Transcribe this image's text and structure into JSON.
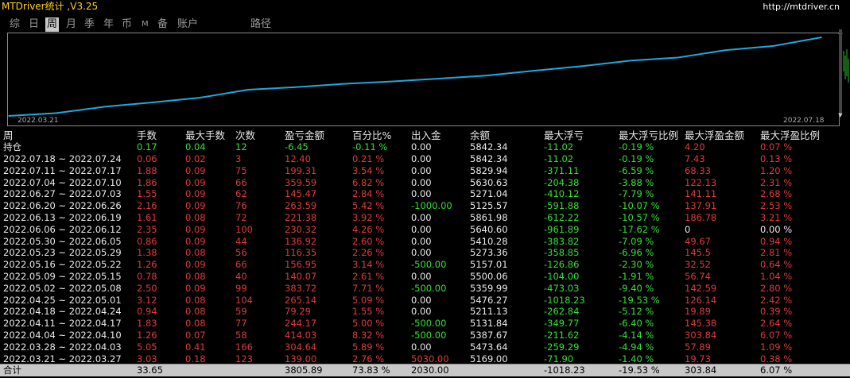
{
  "app": {
    "title": "MTDriver统计 ,V3.25",
    "site": "http://mtdriver.cn"
  },
  "tabs": [
    {
      "label": "综"
    },
    {
      "label": "日"
    },
    {
      "label": "周",
      "active": true
    },
    {
      "label": "月"
    },
    {
      "label": "季"
    },
    {
      "label": "年"
    },
    {
      "label": "币"
    },
    {
      "label": "M"
    },
    {
      "label": "备"
    },
    {
      "label": "账户"
    },
    {
      "label": "路径"
    }
  ],
  "chart_data": {
    "type": "line",
    "x_start_label": "2022.03.21",
    "x_end_label": "2022.07.18",
    "line_color": "#1fa8dc",
    "series": [
      {
        "values": [
          0,
          139.0,
          443.64,
          648.38,
          880.42,
          1263.37,
          1386.31,
          1543.25,
          1659.6,
          1797.32,
          1947.24,
          2177.56,
          2398.94,
          2662.53,
          2810.0,
          3169.59,
          3369.11,
          3783.49
        ]
      }
    ],
    "ylim": [
      0,
      3900
    ]
  },
  "table": {
    "headers": [
      "周",
      "手数",
      "最大手数",
      "次数",
      "盈亏金额",
      "百分比%",
      "出入金",
      "余额",
      "最大浮亏",
      "最大浮亏比例",
      "最大浮盈金额",
      "最大浮盈比例"
    ],
    "holding": [
      "持仓",
      "0.17",
      "0.04",
      "12",
      "-6.45",
      "-0.11 %",
      "0.00",
      "5842.34",
      "-11.02",
      "-0.19 %",
      "4.20",
      "0.07 %"
    ],
    "rows": [
      [
        "2022.07.18 ~ 2022.07.24",
        "0.06",
        "0.02",
        "3",
        "12.40",
        "0.21 %",
        "0.00",
        "5842.34",
        "-11.02",
        "-0.19 %",
        "7.43",
        "0.13 %"
      ],
      [
        "2022.07.11 ~ 2022.07.17",
        "1.88",
        "0.09",
        "75",
        "199.31",
        "3.54 %",
        "0.00",
        "5829.94",
        "-371.11",
        "-6.59 %",
        "68.33",
        "1.20 %"
      ],
      [
        "2022.07.04 ~ 2022.07.10",
        "1.86",
        "0.09",
        "66",
        "359.59",
        "6.82 %",
        "0.00",
        "5630.63",
        "-204.38",
        "-3.88 %",
        "122.13",
        "2.31 %"
      ],
      [
        "2022.06.27 ~ 2022.07.03",
        "1.55",
        "0.09",
        "62",
        "145.47",
        "2.84 %",
        "0.00",
        "5271.04",
        "-410.12",
        "-7.79 %",
        "141.11",
        "2.68 %"
      ],
      [
        "2022.06.20 ~ 2022.06.26",
        "2.16",
        "0.09",
        "76",
        "263.59",
        "5.42 %",
        "-1000.00",
        "5125.57",
        "-591.88",
        "-10.07 %",
        "137.91",
        "2.53 %"
      ],
      [
        "2022.06.13 ~ 2022.06.19",
        "1.61",
        "0.08",
        "72",
        "221.38",
        "3.92 %",
        "0.00",
        "5861.98",
        "-612.22",
        "-10.57 %",
        "186.78",
        "3.21 %"
      ],
      [
        "2022.06.06 ~ 2022.06.12",
        "2.35",
        "0.09",
        "100",
        "230.32",
        "4.26 %",
        "0.00",
        "5640.60",
        "-961.89",
        "-17.62 %",
        "0",
        "0.00 %"
      ],
      [
        "2022.05.30 ~ 2022.06.05",
        "0.86",
        "0.09",
        "44",
        "136.92",
        "2.60 %",
        "0.00",
        "5410.28",
        "-383.82",
        "-7.09 %",
        "49.67",
        "0.94 %"
      ],
      [
        "2022.05.23 ~ 2022.05.29",
        "1.38",
        "0.08",
        "56",
        "116.35",
        "2.26 %",
        "0.00",
        "5273.36",
        "-358.85",
        "-6.96 %",
        "145.5",
        "2.81 %"
      ],
      [
        "2022.05.16 ~ 2022.05.22",
        "1.26",
        "0.09",
        "66",
        "156.95",
        "3.14 %",
        "-500.00",
        "5157.01",
        "-126.86",
        "-2.30 %",
        "32.52",
        "0.64 %"
      ],
      [
        "2022.05.09 ~ 2022.05.15",
        "0.78",
        "0.08",
        "40",
        "140.07",
        "2.61 %",
        "0.00",
        "5500.06",
        "-104.00",
        "-1.91 %",
        "56.74",
        "1.04 %"
      ],
      [
        "2022.05.02 ~ 2022.05.08",
        "2.50",
        "0.09",
        "99",
        "383.72",
        "7.71 %",
        "-500.00",
        "5359.99",
        "-473.03",
        "-9.40 %",
        "142.59",
        "2.80 %"
      ],
      [
        "2022.04.25 ~ 2022.05.01",
        "3.12",
        "0.08",
        "104",
        "265.14",
        "5.09 %",
        "0.00",
        "5476.27",
        "-1018.23",
        "-19.53 %",
        "126.14",
        "2.42 %"
      ],
      [
        "2022.04.18 ~ 2022.04.24",
        "0.94",
        "0.08",
        "59",
        "79.29",
        "1.55 %",
        "0.00",
        "5211.13",
        "-262.84",
        "-5.12 %",
        "19.89",
        "0.39 %"
      ],
      [
        "2022.04.11 ~ 2022.04.17",
        "1.83",
        "0.08",
        "77",
        "244.17",
        "5.00 %",
        "-500.00",
        "5131.84",
        "-349.77",
        "-6.40 %",
        "145.38",
        "2.64 %"
      ],
      [
        "2022.04.04 ~ 2022.04.10",
        "1.26",
        "0.07",
        "58",
        "414.03",
        "8.32 %",
        "-500.00",
        "5387.67",
        "-211.62",
        "-4.14 %",
        "303.84",
        "6.07 %"
      ],
      [
        "2022.03.28 ~ 2022.04.03",
        "5.05",
        "0.41",
        "166",
        "304.64",
        "5.89 %",
        "0.00",
        "5473.64",
        "-259.29",
        "-4.94 %",
        "57.89",
        "1.09 %"
      ],
      [
        "2022.03.21 ~ 2022.03.27",
        "3.03",
        "0.18",
        "123",
        "139.00",
        "2.76 %",
        "5030.00",
        "5169.00",
        "-71.90",
        "-1.40 %",
        "19.73",
        "0.38 %"
      ]
    ],
    "total": [
      "合计",
      "33.65",
      "",
      "",
      "3805.89",
      "73.83 %",
      "2030.00",
      "",
      "-1018.23",
      "-19.53 %",
      "303.84",
      "6.07 %"
    ]
  }
}
